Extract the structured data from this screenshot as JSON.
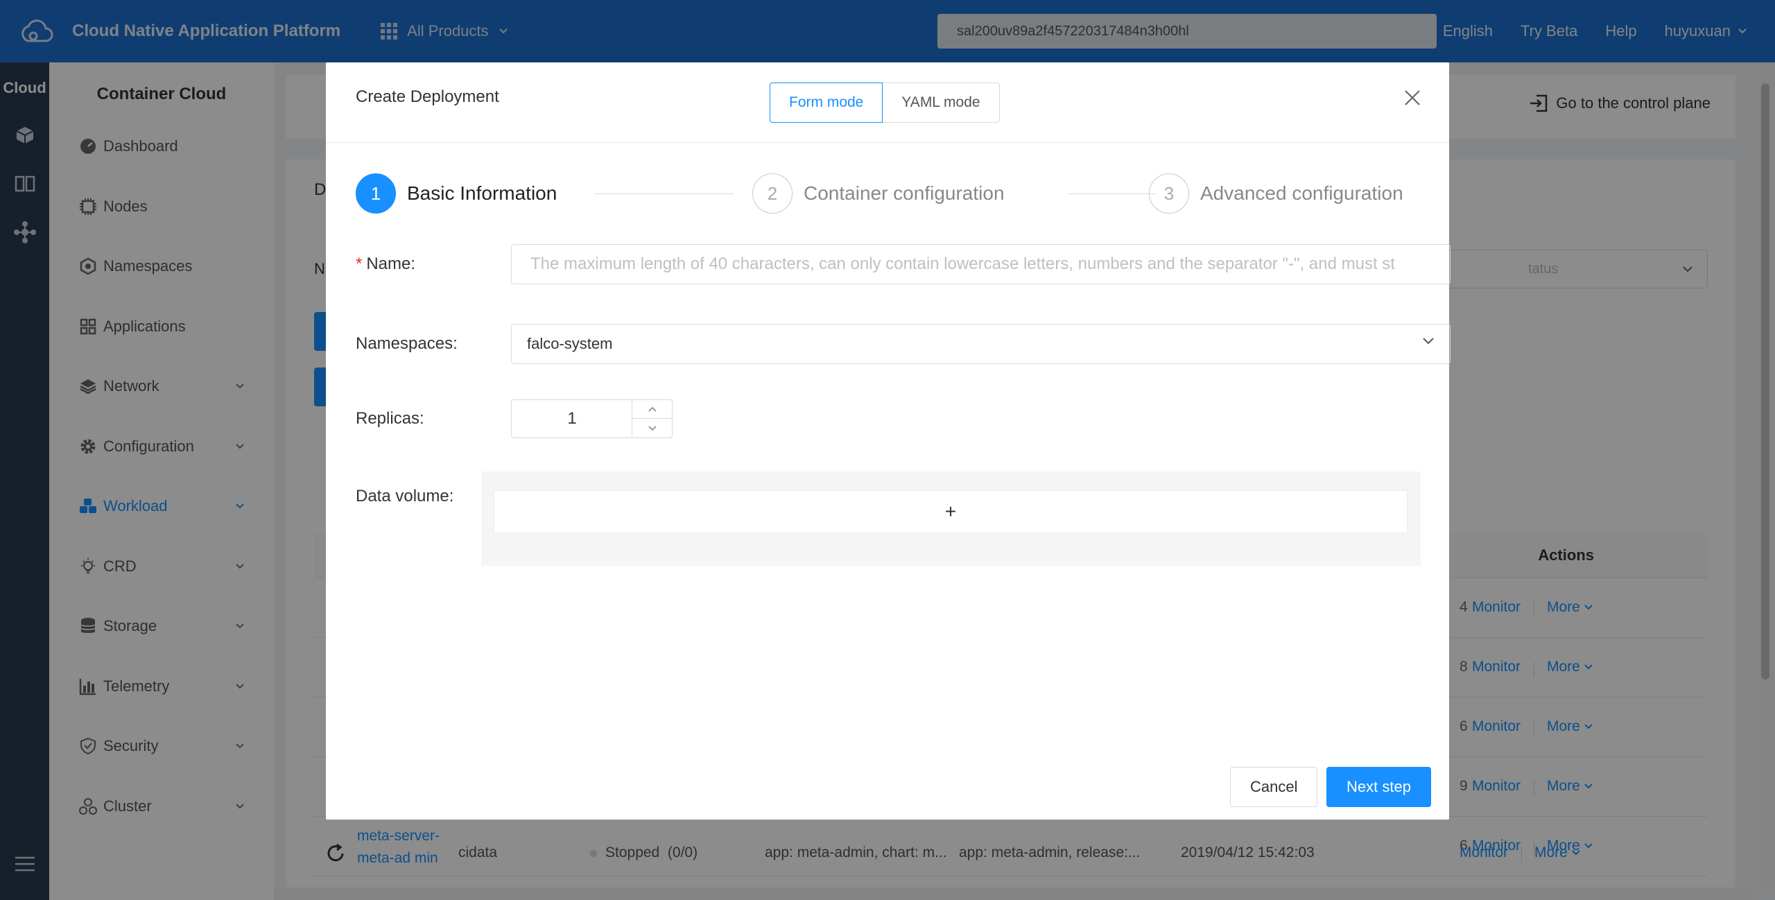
{
  "header": {
    "app_title": "Cloud Native Application Platform",
    "products_label": "All Products",
    "search_value": "sal200uv89a2f457220317484n3h00hl",
    "links": [
      "English",
      "Try Beta",
      "Help",
      "huyuxuan"
    ]
  },
  "rail": {
    "title": "Cloud"
  },
  "sidebar": {
    "title": "Container Cloud",
    "items": [
      {
        "label": "Dashboard",
        "icon": "dashboard-icon"
      },
      {
        "label": "Nodes",
        "icon": "chip-icon"
      },
      {
        "label": "Namespaces",
        "icon": "hexagon-icon"
      },
      {
        "label": "Applications",
        "icon": "grid-icon"
      },
      {
        "label": "Network",
        "icon": "layers-icon"
      },
      {
        "label": "Configuration",
        "icon": "gear-icon"
      },
      {
        "label": "Workload",
        "icon": "cubes-icon"
      },
      {
        "label": "CRD",
        "icon": "bulb-icon"
      },
      {
        "label": "Storage",
        "icon": "database-icon"
      },
      {
        "label": "Telemetry",
        "icon": "bar-chart-icon"
      },
      {
        "label": "Security",
        "icon": "shield-icon"
      },
      {
        "label": "Cluster",
        "icon": "cluster-icon"
      }
    ]
  },
  "background": {
    "control_plane": "Go to the control plane",
    "tab_fragment": "D",
    "name_fragment": "N",
    "status_placeholder": "tatus",
    "actions_header": "Actions",
    "row_fragments": [
      "4",
      "8",
      "6",
      "9",
      "6"
    ],
    "monitor_label": "Monitor",
    "more_label": "More",
    "last_row": {
      "name": "meta-server-meta-ad min",
      "namespace": "cidata",
      "status": "Stopped  (0/0)",
      "labels": "app: meta-admin, chart: m...",
      "selector": "app: meta-admin, release:...",
      "time": "2019/04/12 15:42:03"
    }
  },
  "modal": {
    "title": "Create Deployment",
    "modes": [
      "Form mode",
      "YAML mode"
    ],
    "steps": [
      {
        "num": "1",
        "label": "Basic Information"
      },
      {
        "num": "2",
        "label": "Container configuration"
      },
      {
        "num": "3",
        "label": "Advanced configuration"
      }
    ],
    "name_label": "Name:",
    "name_placeholder": "The maximum length of 40 characters, can only contain lowercase letters, numbers and the separator \"-\", and must st",
    "namespace_label": "Namespaces:",
    "namespace_value": "falco-system",
    "replicas_label": "Replicas:",
    "replicas_value": "1",
    "volume_label": "Data volume:",
    "volume_add": "+",
    "cancel": "Cancel",
    "next": "Next step"
  },
  "colors": {
    "brand": "#1e6fce",
    "accent": "#1890ff",
    "rail": "#2b3a4e"
  }
}
